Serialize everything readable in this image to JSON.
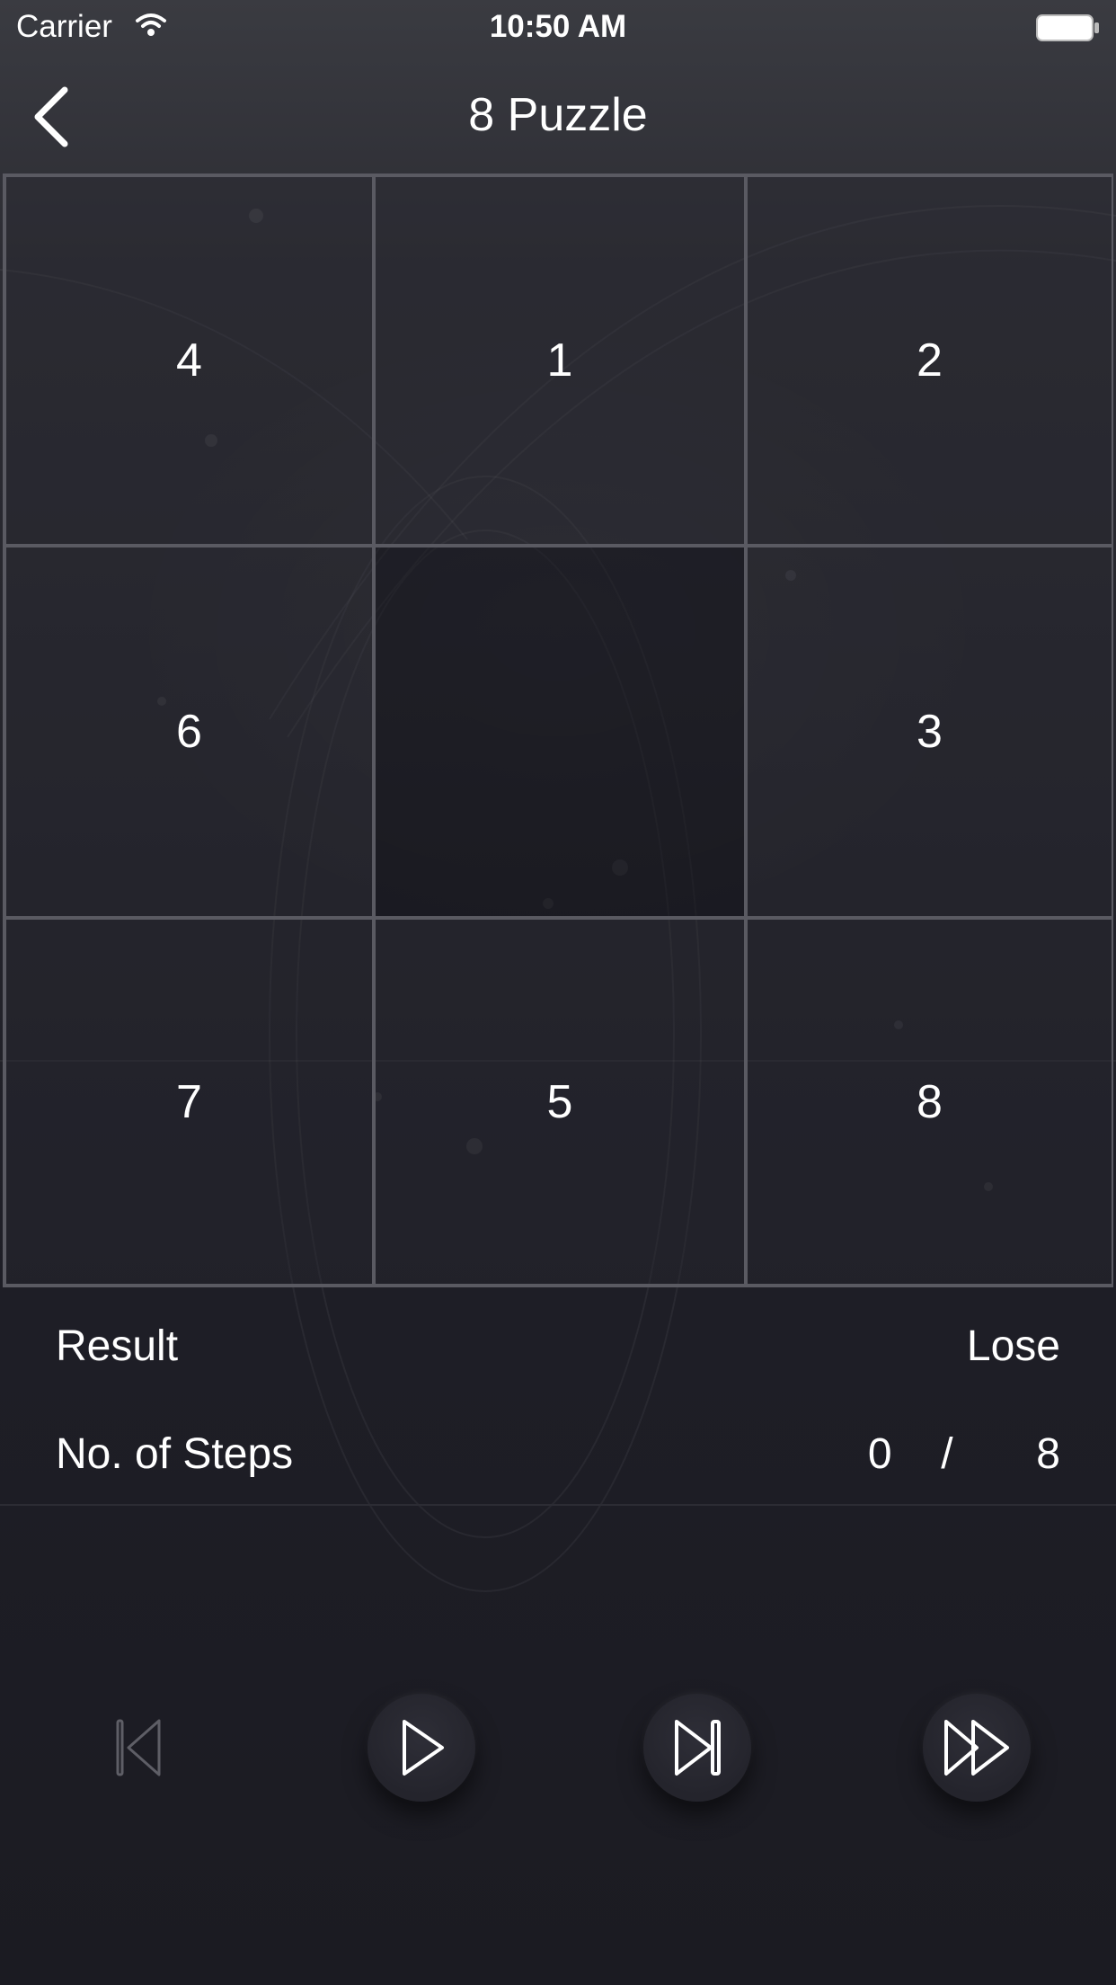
{
  "status_bar": {
    "carrier": "Carrier",
    "time": "10:50 AM",
    "wifi_icon": "wifi-icon",
    "battery_icon": "battery-icon"
  },
  "nav": {
    "back_icon": "chevron-left-icon",
    "title": "8 Puzzle"
  },
  "board": {
    "tiles": [
      "4",
      "1",
      "2",
      "6",
      "",
      "3",
      "7",
      "5",
      "8"
    ]
  },
  "result": {
    "label": "Result",
    "value": "Lose"
  },
  "steps": {
    "label": "No. of Steps",
    "current": "0",
    "separator": "/",
    "total": "8"
  },
  "controls": {
    "items": [
      {
        "icon": "skip-to-start-icon",
        "enabled": false
      },
      {
        "icon": "play-icon",
        "enabled": true
      },
      {
        "icon": "step-forward-icon",
        "enabled": true
      },
      {
        "icon": "fast-forward-icon",
        "enabled": true
      }
    ]
  },
  "colors": {
    "background": "#1d1d25",
    "grid_line": "#5a5a62",
    "text": "#ffffff",
    "disabled_icon": "#5e5e66"
  }
}
